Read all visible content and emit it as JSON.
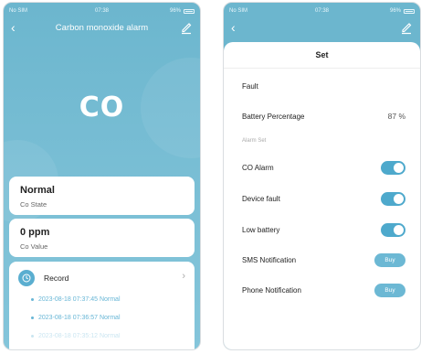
{
  "colors": {
    "accent": "#6cb6ce",
    "toggle_on": "#4ea9cc",
    "record_text": "#67b6d6"
  },
  "left": {
    "status": {
      "carrier": "No SIM",
      "time": "07:38",
      "battery": "96%"
    },
    "title": "Carbon monoxide alarm",
    "big_label": "CO",
    "state_card": {
      "value": "Normal",
      "label": "Co State"
    },
    "value_card": {
      "value": "0 ppm",
      "label": "Co Value"
    },
    "record": {
      "title": "Record",
      "items": [
        "2023-08-18 07:37:45 Normal",
        "2023-08-18 07:36:57 Normal",
        "2023-08-18 07:35:12 Normal"
      ]
    }
  },
  "right": {
    "status": {
      "carrier": "No SIM",
      "time": "07:38",
      "battery": "96%"
    },
    "sheet_title": "Set",
    "fault_label": "Fault",
    "battery_label": "Battery Percentage",
    "battery_value": "87 %",
    "section_label": "Alarm Set",
    "toggles": [
      {
        "label": "CO Alarm",
        "on": true
      },
      {
        "label": "Device fault",
        "on": true
      },
      {
        "label": "Low battery",
        "on": true
      }
    ],
    "sms": {
      "label": "SMS Notification",
      "button": "Buy"
    },
    "phone": {
      "label": "Phone Notification",
      "button": "Buy"
    }
  }
}
